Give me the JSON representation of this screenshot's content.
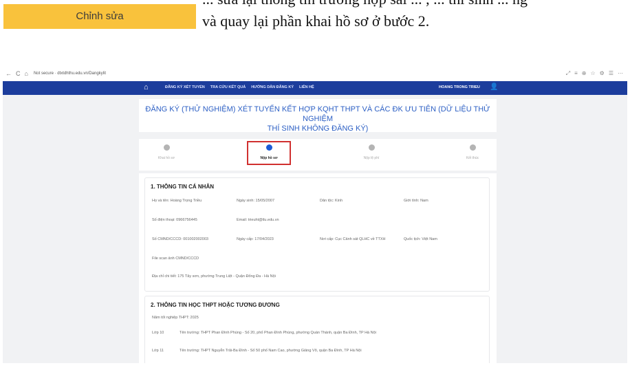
{
  "document": {
    "edit_button": "Chỉnh sửa",
    "instruction": "và quay lại phần khai hồ sơ ở bước 2.",
    "instruction_cut": "... sửa lại thông tin trường hợp sai ... , ... thí sinh ... ng"
  },
  "browser": {
    "url": "Not secure · dtxtdhthu.edu.vn/Dangkylit",
    "nav_icons": [
      "←",
      "C",
      "⌂"
    ],
    "tool_icons": [
      "⤢",
      "≡",
      "⊕",
      "☆",
      "⚙",
      "☰",
      "⋯"
    ]
  },
  "navbar": {
    "home_icon": "⌂",
    "menu": [
      "ĐĂNG KÝ XÉT TUYỂN",
      "TRA CỨU KẾT QUẢ",
      "HƯỚNG DẪN ĐĂNG KÝ",
      "LIÊN HỆ"
    ],
    "user": "HOANG TRONG TRIEU",
    "user_icon": "👤"
  },
  "title": {
    "line1": "ĐĂNG KÝ (THỬ NGHIỆM) XÉT TUYỂN KẾT HỢP KQHT THPT VÀ CÁC ĐK ƯU TIÊN (DỮ LIỆU THỬ NGHIỆM",
    "line2": "THÍ SINH KHÔNG ĐĂNG KÝ)"
  },
  "steps": [
    {
      "label": "Khai hồ sơ",
      "active": false
    },
    {
      "label": "Nộp hồ sơ",
      "active": true
    },
    {
      "label": "Nộp lệ phí",
      "active": false
    },
    {
      "label": "Kết thúc",
      "active": false
    }
  ],
  "section1": {
    "title": "1. THÔNG TIN CÁ NHÂN",
    "fullname": "Họ và tên: Hoàng Trọng Triều",
    "dob": "Ngày sinh: 15/05/2007",
    "ethnicity": "Dân tộc: Kinh",
    "gender": "Giới tính: Nam",
    "phone": "Số điện thoại: 0966756445",
    "email": "Email: trieuht@tlu.edu.vn",
    "id_number": "Số CMND/CCCD: 001002002003",
    "issue_date": "Ngày cấp: 17/04/2023",
    "issue_place": "Nơi cấp: Cục Cảnh sát QLHC về TTXH",
    "nationality": "Quốc tịch: Việt Nam",
    "id_scan": "File scan ảnh CMND/CCCD",
    "address": "Địa chỉ chi tiết: 175 Tây sơn, phường Trung Liệt - Quận Đống Đa - Hà Nội"
  },
  "section2": {
    "title": "2. THÔNG TIN HỌC THPT HOẶC TƯƠNG ĐƯƠNG",
    "grad_year": "Năm tốt nghiệp THPT: 2025",
    "grade10_label": "Lớp 10",
    "grade10_school": "Tên trường: THPT Phan Đình Phùng - Số 20, phố Phan Đình Phùng, phường Quán Thánh, quận Ba Đình, TP Hà Nội",
    "grade11_label": "Lớp 11",
    "grade11_school": "Tên trường: THPT Nguyễn Trãi-Ba Đình - Số 50 phố Nam Cao, phường Giảng Võ, quận Ba Đình, TP Hà Nội"
  }
}
